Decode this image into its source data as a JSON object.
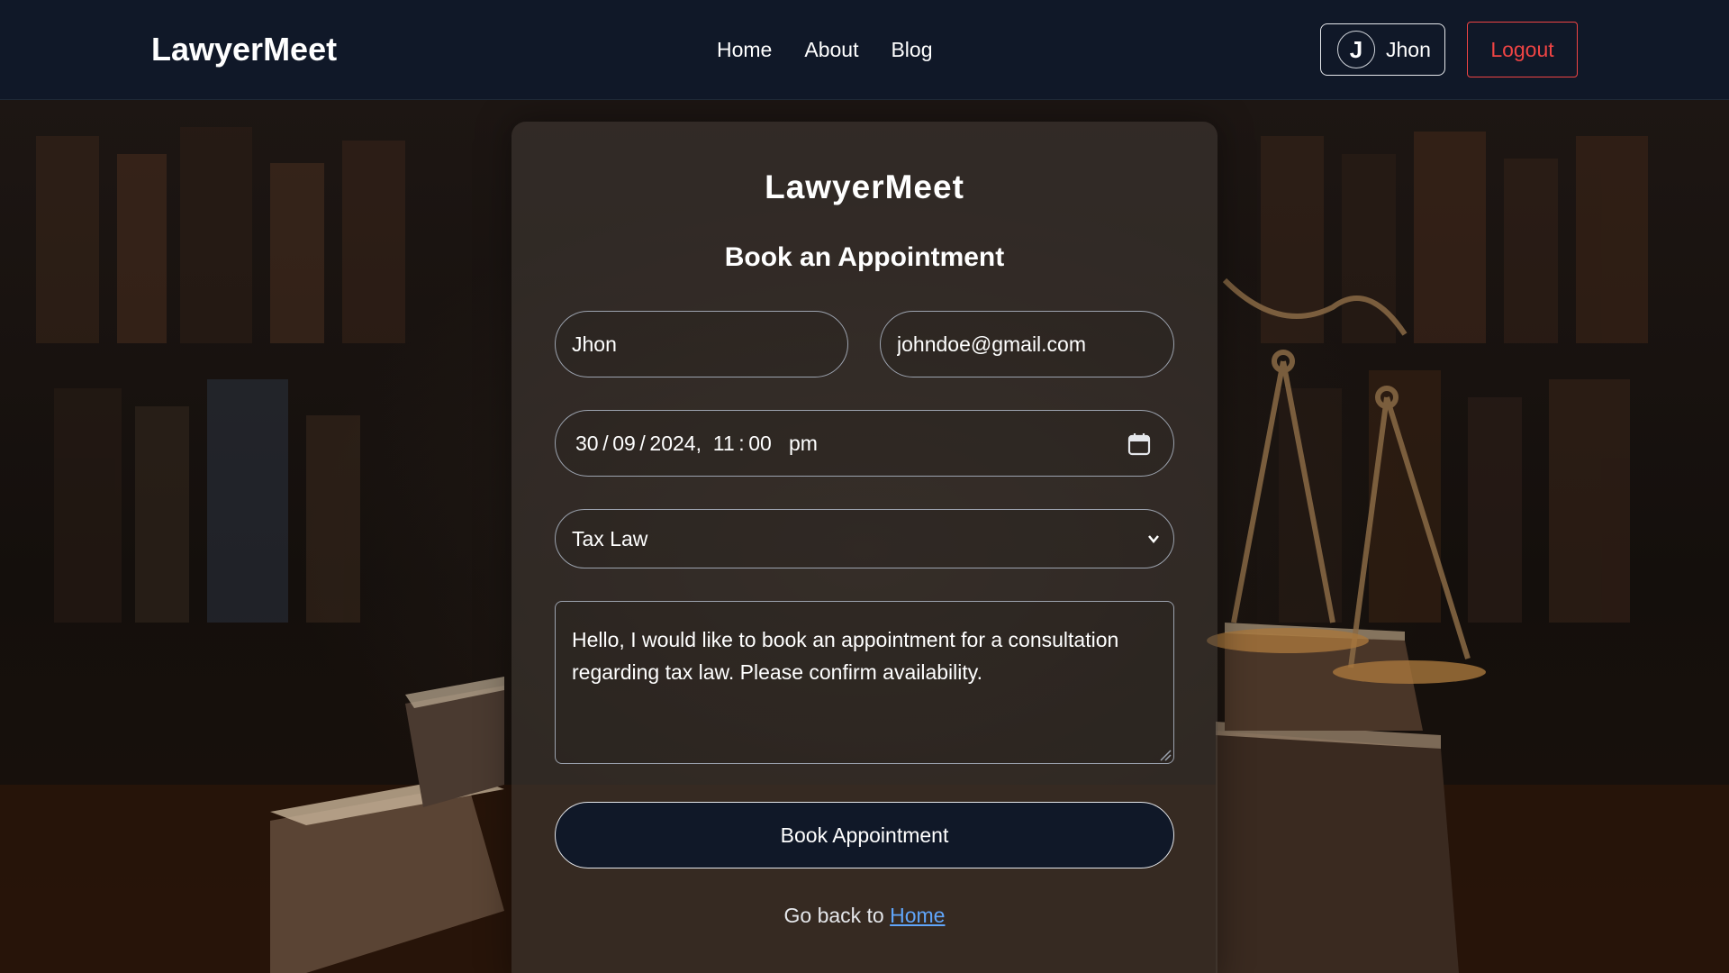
{
  "header": {
    "brand": "LawyerMeet",
    "nav": [
      {
        "label": "Home"
      },
      {
        "label": "About"
      },
      {
        "label": "Blog"
      }
    ],
    "user": {
      "initial": "J",
      "name": "Jhon"
    },
    "logout_label": "Logout"
  },
  "card": {
    "brand": "LawyerMeet",
    "title": "Book an Appointment",
    "form": {
      "name_value": "Jhon",
      "email_value": "johndoe@gmail.com",
      "datetime": {
        "day": "30",
        "month": "09",
        "year": "2024",
        "hour": "11",
        "minute": "00",
        "ampm": "pm"
      },
      "practice_area": "Tax Law",
      "message": "Hello, I would like to book an appointment for a consultation regarding tax law. Please confirm availability.",
      "submit_label": "Book Appointment"
    },
    "footer": {
      "text": "Go back to",
      "link_label": "Home"
    }
  },
  "colors": {
    "navbar_bg": "#101828",
    "logout": "#ef4444",
    "link": "#60a5fa",
    "button_bg": "#101828"
  }
}
